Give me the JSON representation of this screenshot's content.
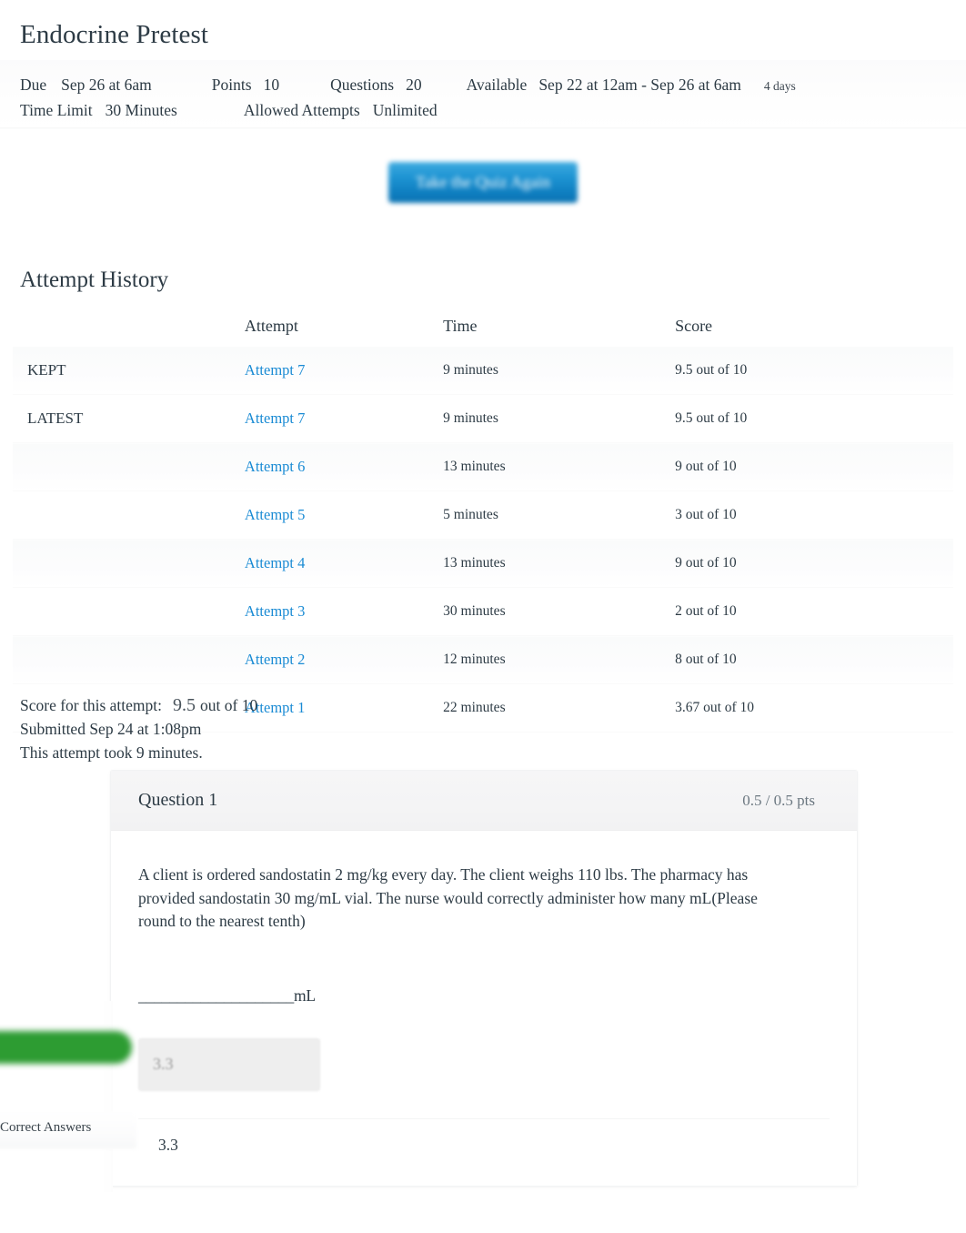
{
  "quiz": {
    "title": "Endocrine Pretest"
  },
  "meta": {
    "due_label": "Due",
    "due_value": "Sep 26 at 6am",
    "points_label": "Points",
    "points_value": "10",
    "questions_label": "Questions",
    "questions_value": "20",
    "available_label": "Available",
    "available_value": "Sep 22 at 12am - Sep 26 at 6am",
    "days_badge": "4 days",
    "time_limit_label": "Time Limit",
    "time_limit_value": "30 Minutes",
    "allowed_attempts_label": "Allowed Attempts",
    "allowed_attempts_value": "Unlimited"
  },
  "actions": {
    "retake_label": "Take the Quiz Again"
  },
  "attempt_history": {
    "heading": "Attempt History",
    "columns": {
      "flag": "",
      "attempt": "Attempt",
      "time": "Time",
      "score": "Score"
    },
    "rows": [
      {
        "flag": "KEPT",
        "attempt": "Attempt 7",
        "time": "9 minutes",
        "score": "9.5 out of 10"
      },
      {
        "flag": "LATEST",
        "attempt": "Attempt 7",
        "time": "9 minutes",
        "score": "9.5 out of 10"
      },
      {
        "flag": "",
        "attempt": "Attempt 6",
        "time": "13 minutes",
        "score": "9 out of 10"
      },
      {
        "flag": "",
        "attempt": "Attempt 5",
        "time": "5 minutes",
        "score": "3 out of 10"
      },
      {
        "flag": "",
        "attempt": "Attempt 4",
        "time": "13 minutes",
        "score": "9 out of 10"
      },
      {
        "flag": "",
        "attempt": "Attempt 3",
        "time": "30 minutes",
        "score": "2 out of 10"
      },
      {
        "flag": "",
        "attempt": "Attempt 2",
        "time": "12 minutes",
        "score": "8 out of 10"
      },
      {
        "flag": "",
        "attempt": "Attempt 1",
        "time": "22 minutes",
        "score": "3.67 out of 10"
      }
    ]
  },
  "attempt_result": {
    "score_label": "Score for this attempt:",
    "score_value": "9.5",
    "score_suffix": "out of 10",
    "submitted": "Submitted Sep 24 at 1:08pm",
    "duration": "This attempt took 9 minutes."
  },
  "question": {
    "name": "Question 1",
    "points": "0.5 / 0.5 pts",
    "text": "A client is ordered sandostatin 2 mg/kg every day. The client weighs 110 lbs. The pharmacy has provided sandostatin 30 mg/mL vial. The nurse would correctly administer how many mL(Please round to the nearest tenth)",
    "blank_line": "____________________mL",
    "answer_value": "3.3",
    "correct_answers_label": "Correct Answers",
    "correct_answer_value": "3.3"
  },
  "colors": {
    "link_blue": "#1a8bd4",
    "button_blue": "#0e7ec0",
    "correct_green": "#2d9c32",
    "text": "#2d3b45"
  }
}
